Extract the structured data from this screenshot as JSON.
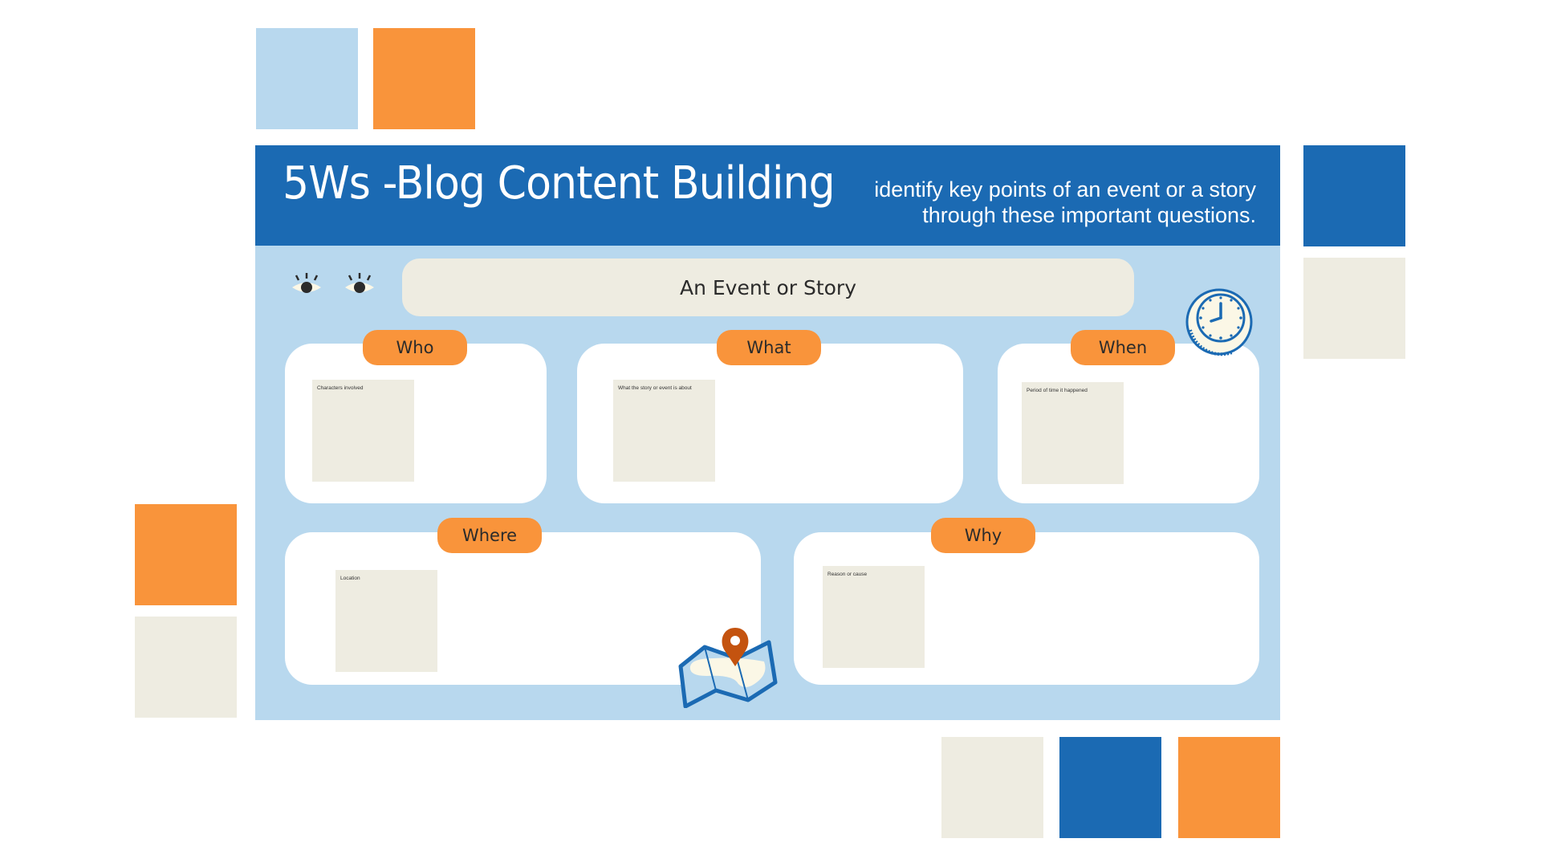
{
  "header": {
    "title": "5Ws -Blog Content Building",
    "subtitle_line1": "identify key points of an event or a story",
    "subtitle_line2": "through these important questions."
  },
  "banner": {
    "label": "An Event or Story"
  },
  "cards": [
    {
      "tab": "Who",
      "note": "Characters involved"
    },
    {
      "tab": "What",
      "note": "What the story or event is about"
    },
    {
      "tab": "When",
      "note": "Period of time it happened"
    },
    {
      "tab": "Where",
      "note": "Location"
    },
    {
      "tab": "Why",
      "note": "Reason or cause"
    }
  ],
  "icons": [
    "eye-icon",
    "eye-icon",
    "clock-icon",
    "map-pin-icon"
  ],
  "palette": {
    "dark_blue": "#1b6ab3",
    "light_blue": "#b8d8ee",
    "orange": "#f9943b",
    "beige": "#eeece1",
    "pin": "#c4530f"
  }
}
